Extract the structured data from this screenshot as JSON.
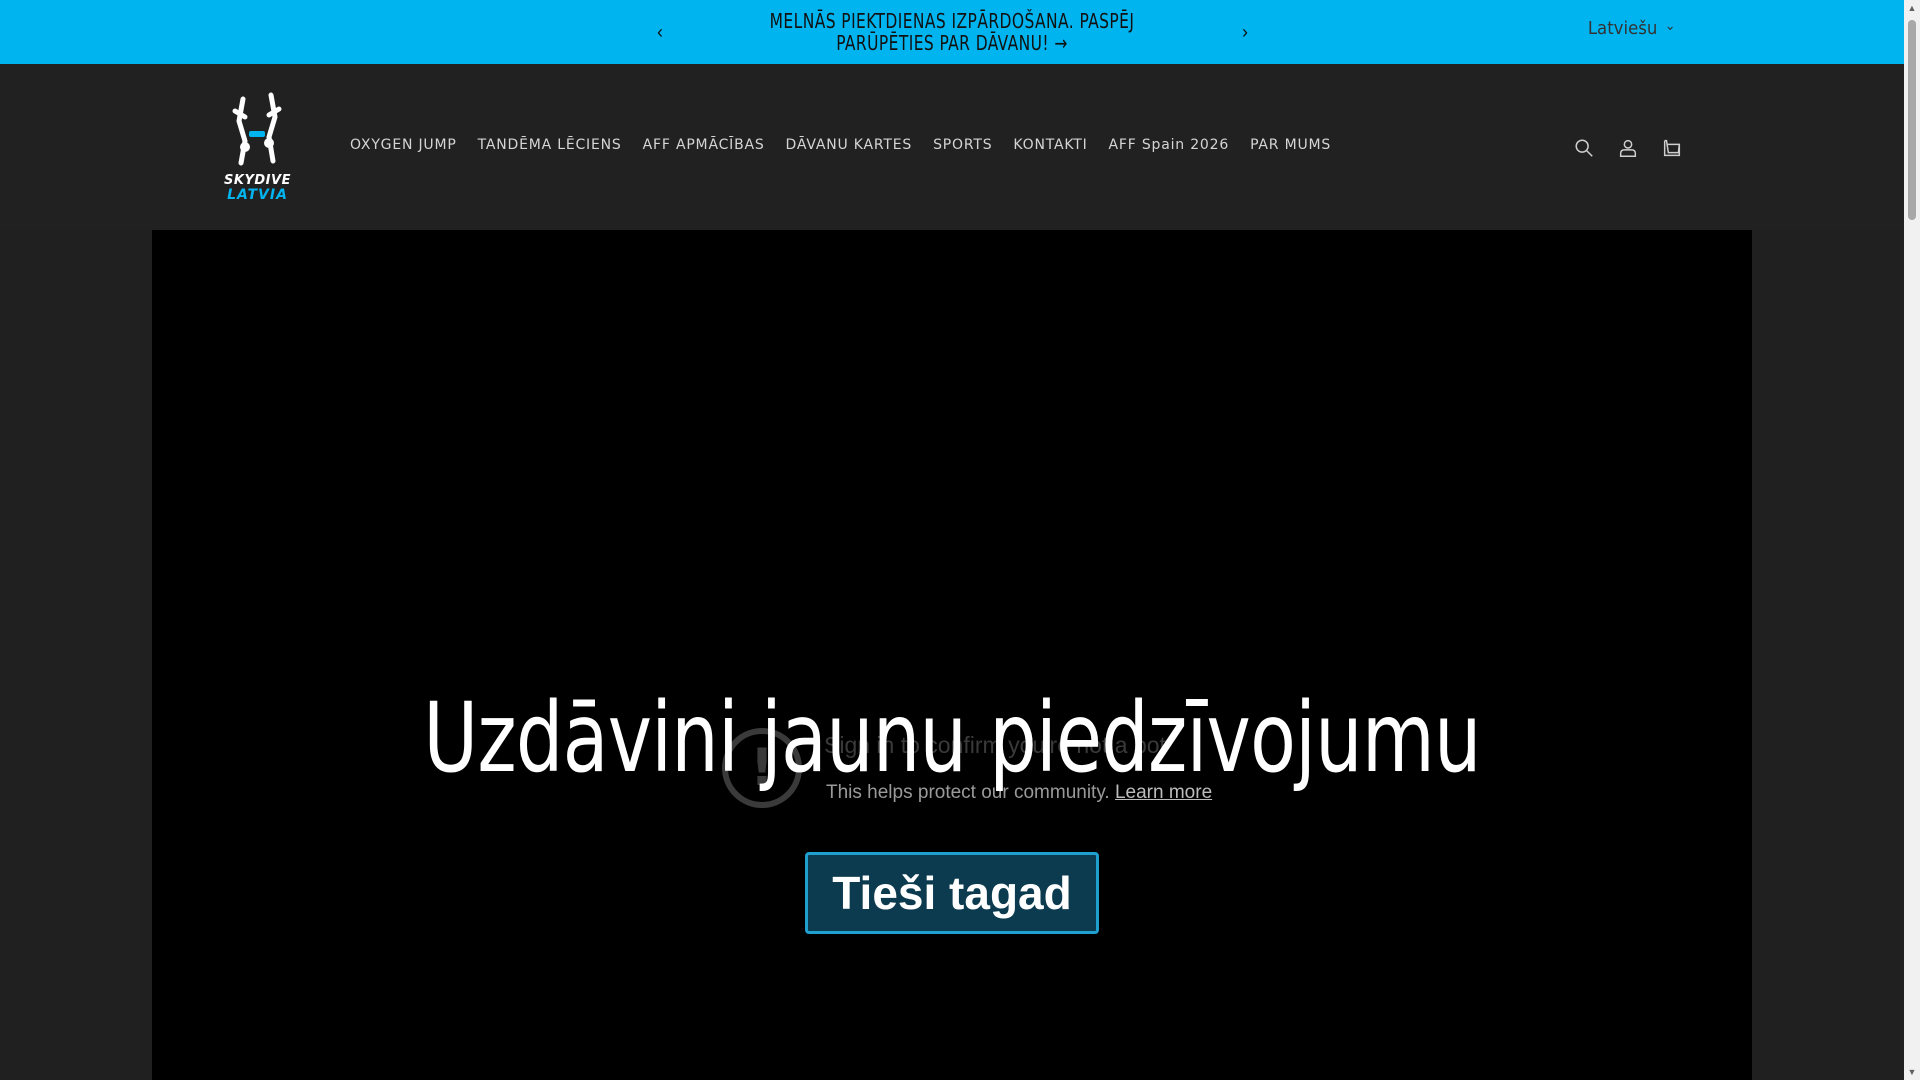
{
  "announcement": {
    "text": "MELNĀS PIEKTDIENAS IZPĀRDOŠANA. PASPĒJ PARŪPĒTIES PAR DĀVANU! →",
    "prev_glyph": "‹",
    "next_glyph": "›"
  },
  "language": {
    "label": "Latviešu",
    "chevron": "⌄"
  },
  "logo": {
    "line1": "SKYDIVE",
    "line2": "LATVIA"
  },
  "nav": {
    "items": [
      {
        "label": "OXYGEN JUMP"
      },
      {
        "label": "TANDĒMA LĒCIENS"
      },
      {
        "label": "AFF APMĀCĪBAS"
      },
      {
        "label": "DĀVANU KARTES"
      },
      {
        "label": "SPORTS"
      },
      {
        "label": "KONTAKTI"
      },
      {
        "label": "AFF Spain 2026"
      },
      {
        "label": "PAR MUMS"
      }
    ]
  },
  "hero": {
    "title": "Uzdāvini jaunu piedzīvojumu",
    "cta_label": "Tieši tagad"
  },
  "captcha": {
    "icon_glyph": "!",
    "title": "Sign in to confirm you're not a bot",
    "subtitle": "This helps protect our community.",
    "learn_more": "Learn more"
  },
  "colors": {
    "accent": "#00b4f0",
    "header_bg": "#212121",
    "hero_bg": "#000000",
    "cta_bg": "#0c3a4e",
    "cta_border": "#1fa0cf"
  }
}
